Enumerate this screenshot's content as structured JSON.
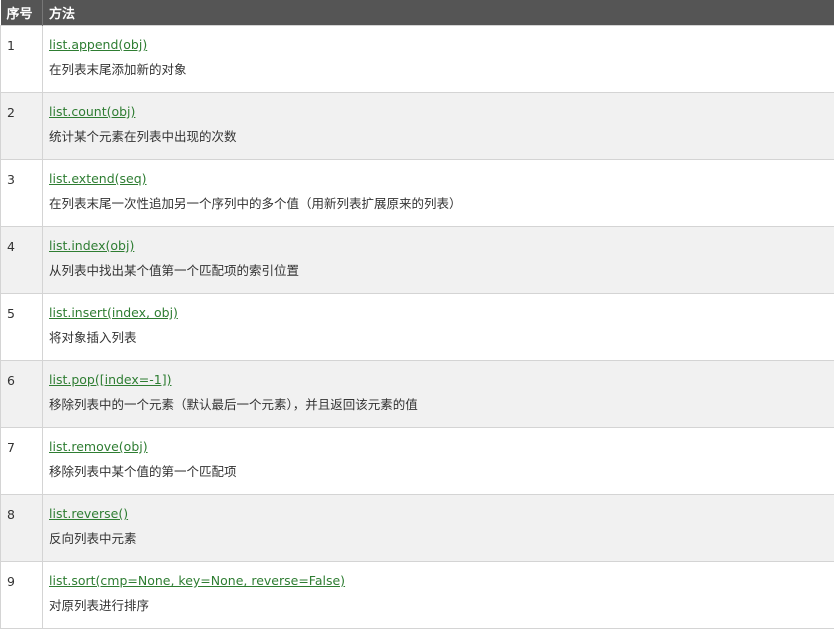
{
  "header": {
    "col_num": "序号",
    "col_method": "方法"
  },
  "rows": [
    {
      "num": "1",
      "sig": "list.append(obj)",
      "desc": "在列表末尾添加新的对象"
    },
    {
      "num": "2",
      "sig": "list.count(obj)",
      "desc": "统计某个元素在列表中出现的次数"
    },
    {
      "num": "3",
      "sig": "list.extend(seq)",
      "desc": "在列表末尾一次性追加另一个序列中的多个值（用新列表扩展原来的列表）"
    },
    {
      "num": "4",
      "sig": "list.index(obj)",
      "desc": "从列表中找出某个值第一个匹配项的索引位置"
    },
    {
      "num": "5",
      "sig": "list.insert(index, obj)",
      "desc": "将对象插入列表"
    },
    {
      "num": "6",
      "sig": "list.pop([index=-1])",
      "desc": "移除列表中的一个元素（默认最后一个元素），并且返回该元素的值"
    },
    {
      "num": "7",
      "sig": "list.remove(obj)",
      "desc": "移除列表中某个值的第一个匹配项"
    },
    {
      "num": "8",
      "sig": "list.reverse()",
      "desc": "反向列表中元素"
    },
    {
      "num": "9",
      "sig": "list.sort(cmp=None, key=None, reverse=False)",
      "desc": "对原列表进行排序"
    }
  ],
  "colors": {
    "header_bg": "#555555",
    "link": "#2e7d32",
    "row_alt": "#f1f1f1"
  }
}
